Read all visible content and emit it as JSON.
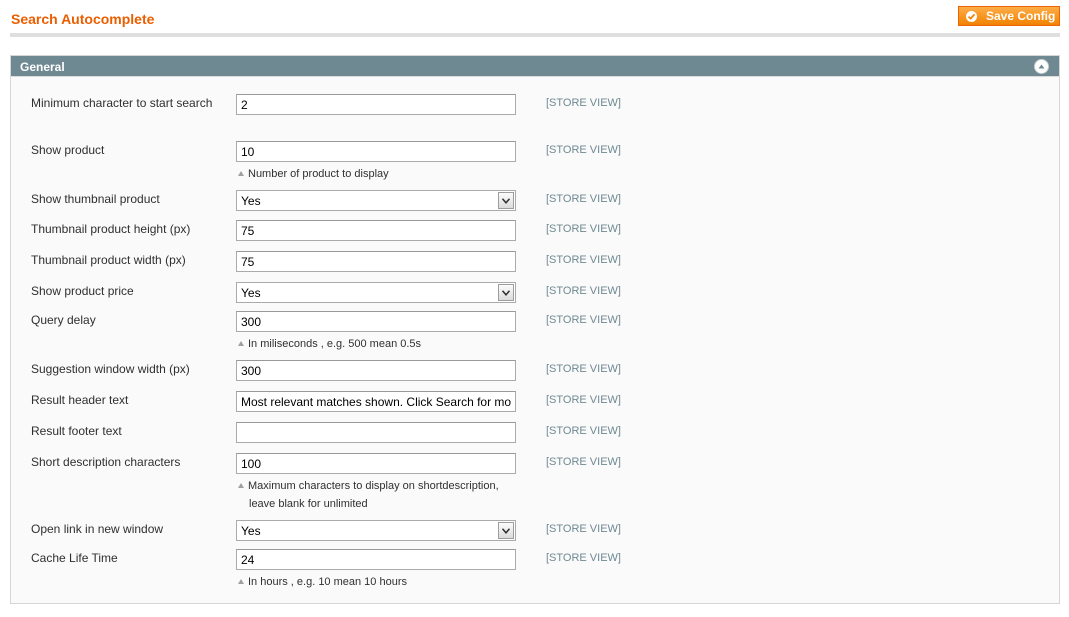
{
  "header": {
    "title": "Search Autocomplete",
    "save_label": "Save Config"
  },
  "fieldset": {
    "title": "General"
  },
  "scope_label": "[STORE VIEW]",
  "fields": [
    {
      "label": "Minimum character to start search",
      "type": "text",
      "value": "2"
    },
    {
      "label": "Show product",
      "type": "text",
      "value": "10",
      "note": "Number of product to display"
    },
    {
      "label": "Show thumbnail product",
      "type": "select",
      "value": "Yes"
    },
    {
      "label": "Thumbnail product height (px)",
      "type": "text",
      "value": "75"
    },
    {
      "label": "Thumbnail product width (px)",
      "type": "text",
      "value": "75"
    },
    {
      "label": "Show product price",
      "type": "select",
      "value": "Yes"
    },
    {
      "label": "Query delay",
      "type": "text",
      "value": "300",
      "note": "In miliseconds , e.g. 500 mean 0.5s"
    },
    {
      "label": "Suggestion window width (px)",
      "type": "text",
      "value": "300"
    },
    {
      "label": "Result header text",
      "type": "text",
      "value": "Most relevant matches shown. Click Search for more items"
    },
    {
      "label": "Result footer text",
      "type": "text",
      "value": ""
    },
    {
      "label": "Short description characters",
      "type": "text",
      "value": "100",
      "note": "Maximum characters to display on shortdescription,",
      "note2": "leave blank for unlimited"
    },
    {
      "label": "Open link in new window",
      "type": "select",
      "value": "Yes"
    },
    {
      "label": "Cache Life Time",
      "type": "text",
      "value": "24",
      "note": "In hours , e.g. 10 mean 10 hours"
    }
  ],
  "colors": {
    "title_orange": "#eb5e00",
    "header_bar": "#6f8992",
    "button_orange": "#f18200"
  },
  "icons": {
    "save": "check-circle-icon",
    "collapse": "chevron-up-icon",
    "dropdown": "chevron-down-icon",
    "note": "triangle-up-icon"
  }
}
